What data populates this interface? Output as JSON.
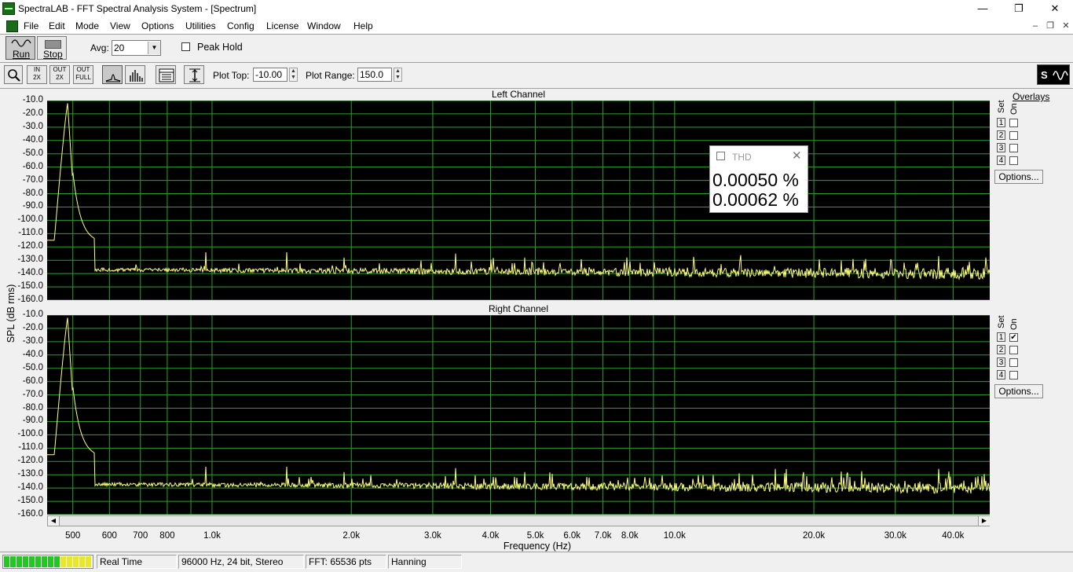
{
  "window": {
    "title": "SpectraLAB - FFT Spectral Analysis System - [Spectrum]",
    "min_glyph": "—",
    "max_glyph": "❐",
    "close_glyph": "✕"
  },
  "menu": {
    "items": [
      "File",
      "Edit",
      "Mode",
      "View",
      "Options",
      "Utilities",
      "Config",
      "License",
      "Window",
      "Help"
    ],
    "mdi_min": "–",
    "mdi_restore": "❐",
    "mdi_close": "✕"
  },
  "toolbar": {
    "run_label": "Run",
    "stop_label": "Stop",
    "avg_label": "Avg:",
    "avg_value": "20",
    "peak_hold_label": "Peak Hold",
    "peak_hold_checked": false,
    "plot_top_label": "Plot Top:",
    "plot_top_value": "-10.00",
    "plot_range_label": "Plot Range:",
    "plot_range_value": "150.0",
    "zoom_in_2x_label": "2X",
    "zoom_out_2x_label": "2X",
    "zoom_full_label": "FULL",
    "in_label": "IN",
    "out_label": "OUT"
  },
  "plots": {
    "y_axis_label": "SPL (dB rms)",
    "x_axis_label": "Frequency (Hz)",
    "y_ticks": [
      "-10.0",
      "-20.0",
      "-30.0",
      "-40.0",
      "-50.0",
      "-60.0",
      "-70.0",
      "-80.0",
      "-90.0",
      "-100.0",
      "-110.0",
      "-120.0",
      "-130.0",
      "-140.0",
      "-150.0",
      "-160.0"
    ],
    "x_ticks": [
      "500",
      "600",
      "700",
      "800",
      "1.0k",
      "2.0k",
      "3.0k",
      "4.0k",
      "5.0k",
      "6.0k",
      "7.0k",
      "8.0k",
      "10.0k",
      "20.0k",
      "30.0k",
      "40.0k"
    ],
    "left_title": "Left Channel",
    "right_title": "Right Channel"
  },
  "overlays": {
    "heading": "Overlays",
    "set_label": "Set",
    "on_label": "On",
    "options_label": "Options...",
    "left_checks": [
      false,
      false,
      false,
      false
    ],
    "right_checks": [
      true,
      false,
      false,
      false
    ],
    "numbers": [
      "1",
      "2",
      "3",
      "4"
    ]
  },
  "thd": {
    "title": "THD",
    "left_value": "0.00050 %",
    "right_value": "0.00062 %"
  },
  "status": {
    "mode": "Real Time",
    "format": "96000 Hz, 24 bit, Stereo",
    "fft": "FFT: 65536 pts",
    "window": "Hanning"
  },
  "colors": {
    "trace": "#ffff80",
    "grid": "#2e9e2e",
    "plot_bg": "#000000",
    "marker_red": "#c00000"
  }
}
